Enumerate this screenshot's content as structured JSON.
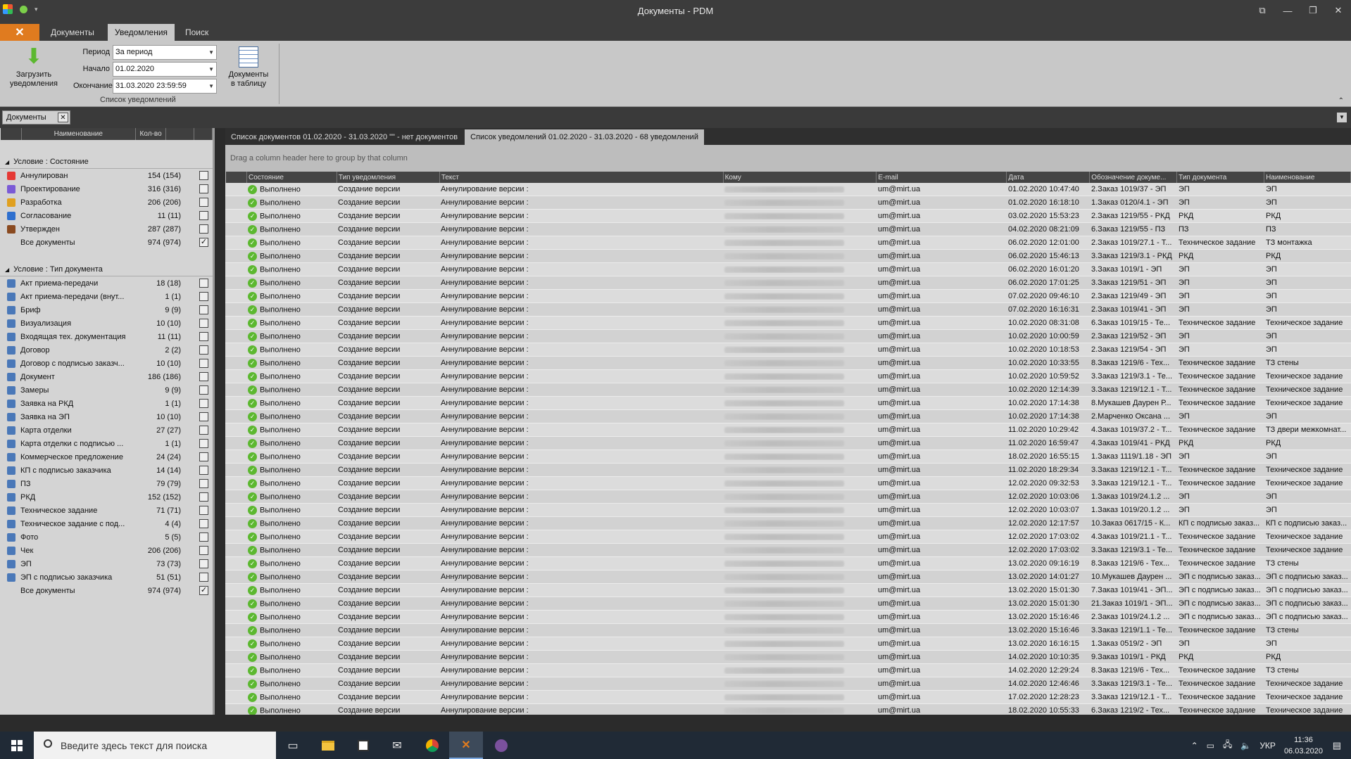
{
  "window": {
    "title": "Документы - PDM",
    "buttons": [
      "⧉",
      "—",
      "❐",
      "✕"
    ]
  },
  "ribbon_tabs": [
    {
      "label": "Документы"
    },
    {
      "label": "Уведомления"
    },
    {
      "label": "Поиск"
    }
  ],
  "ribbon": {
    "load_button": "Загрузить уведомления",
    "load_button_l1": "Загрузить",
    "load_button_l2": "уведомления",
    "period_label": "Период",
    "period_value": "За период",
    "start_label": "Начало",
    "start_value": "01.02.2020",
    "end_label": "Окончание",
    "end_value": "31.03.2020 23:59:59",
    "to_table_l1": "Документы",
    "to_table_l2": "в таблицу",
    "group_label": "Список уведомлений"
  },
  "doc_tab": {
    "label": "Документы",
    "close": "✕"
  },
  "left": {
    "headers": [
      "Наименование",
      "Кол-во"
    ],
    "state_group": "Условие : Состояние",
    "state_items": [
      {
        "name": "Аннулирован",
        "count": "154 (154)",
        "icon": "cancel-icon",
        "checked": false
      },
      {
        "name": "Проектирование",
        "count": "316 (316)",
        "icon": "design-icon",
        "checked": false
      },
      {
        "name": "Разработка",
        "count": "206 (206)",
        "icon": "pencil-icon",
        "checked": false
      },
      {
        "name": "Согласование",
        "count": "11 (11)",
        "icon": "approve-icon",
        "checked": false
      },
      {
        "name": "Утвержден",
        "count": "287 (287)",
        "icon": "stamp-icon",
        "checked": false
      },
      {
        "name": "Все документы",
        "count": "974 (974)",
        "icon": "",
        "checked": true
      }
    ],
    "type_group": "Условие : Тип документа",
    "type_items": [
      {
        "name": "Акт приема-передачи",
        "count": "18 (18)",
        "checked": false
      },
      {
        "name": "Акт приема-передачи (внут...",
        "count": "1 (1)",
        "checked": false
      },
      {
        "name": "Бриф",
        "count": "9 (9)",
        "checked": false
      },
      {
        "name": "Визуализация",
        "count": "10 (10)",
        "checked": false
      },
      {
        "name": "Входящая тех. документация",
        "count": "11 (11)",
        "checked": false
      },
      {
        "name": "Договор",
        "count": "2 (2)",
        "checked": false
      },
      {
        "name": "Договор с подписью заказч...",
        "count": "10 (10)",
        "checked": false
      },
      {
        "name": "Документ",
        "count": "186 (186)",
        "checked": false
      },
      {
        "name": "Замеры",
        "count": "9 (9)",
        "checked": false
      },
      {
        "name": "Заявка на РКД",
        "count": "1 (1)",
        "checked": false
      },
      {
        "name": "Заявка на ЭП",
        "count": "10 (10)",
        "checked": false
      },
      {
        "name": "Карта отделки",
        "count": "27 (27)",
        "checked": false
      },
      {
        "name": "Карта отделки с подписью ...",
        "count": "1 (1)",
        "checked": false
      },
      {
        "name": "Коммерческое предложение",
        "count": "24 (24)",
        "checked": false
      },
      {
        "name": "КП с подписью заказчика",
        "count": "14 (14)",
        "checked": false
      },
      {
        "name": "ПЗ",
        "count": "79 (79)",
        "checked": false
      },
      {
        "name": "РКД",
        "count": "152 (152)",
        "checked": false
      },
      {
        "name": "Техническое задание",
        "count": "71 (71)",
        "checked": false
      },
      {
        "name": "Техническое задание с под...",
        "count": "4 (4)",
        "checked": false
      },
      {
        "name": "Фото",
        "count": "5 (5)",
        "checked": false
      },
      {
        "name": "Чек",
        "count": "206 (206)",
        "checked": false
      },
      {
        "name": "ЭП",
        "count": "73 (73)",
        "checked": false
      },
      {
        "name": "ЭП с подписью заказчика",
        "count": "51 (51)",
        "checked": false
      },
      {
        "name": "Все документы",
        "count": "974 (974)",
        "checked": true
      }
    ]
  },
  "right_tabs": [
    {
      "label": "Список документов 01.02.2020 - 31.03.2020 \"\" - нет документов"
    },
    {
      "label": "Список уведомлений 01.02.2020 - 31.03.2020 - 68 уведомлений"
    }
  ],
  "grid": {
    "group_hint": "Drag a column header here to group by that column",
    "columns": [
      "Состояние",
      "Тип уведомления",
      "Текст",
      "Кому",
      "E-mail",
      "Дата",
      "Обозначение докуме...",
      "Тип документа",
      "Наименование"
    ],
    "status": "Выполнено",
    "notif_type": "Создание версии",
    "text": "Аннулирование версии :",
    "email": "um@mirt.ua",
    "rows": [
      [
        "01.02.2020 10:47:40",
        "2.Заказ 1019/37 - ЭП",
        "ЭП",
        "ЭП"
      ],
      [
        "01.02.2020 16:18:10",
        "1.Заказ 0120/4.1 - ЭП",
        "ЭП",
        "ЭП"
      ],
      [
        "03.02.2020 15:53:23",
        "2.Заказ 1219/55 - РКД",
        "РКД",
        "РКД"
      ],
      [
        "04.02.2020 08:21:09",
        "6.Заказ 1219/55 - ПЗ",
        "ПЗ",
        "ПЗ"
      ],
      [
        "06.02.2020 12:01:00",
        "2.Заказ 1019/27.1 - Т...",
        "Техническое задание",
        "ТЗ монтажка"
      ],
      [
        "06.02.2020 15:46:13",
        "3.Заказ 1219/3.1 - РКД",
        "РКД",
        "РКД"
      ],
      [
        "06.02.2020 16:01:20",
        "3.Заказ 1019/1 - ЭП",
        "ЭП",
        "ЭП"
      ],
      [
        "06.02.2020 17:01:25",
        "3.Заказ 1219/51 - ЭП",
        "ЭП",
        "ЭП"
      ],
      [
        "07.02.2020 09:46:10",
        "2.Заказ 1219/49 - ЭП",
        "ЭП",
        "ЭП"
      ],
      [
        "07.02.2020 16:16:31",
        "2.Заказ 1019/41 - ЭП",
        "ЭП",
        "ЭП"
      ],
      [
        "10.02.2020 08:31:08",
        "6.Заказ 1019/15 - Те...",
        "Техническое задание",
        "Техническое задание"
      ],
      [
        "10.02.2020 10:00:59",
        "2.Заказ 1219/52 - ЭП",
        "ЭП",
        "ЭП"
      ],
      [
        "10.02.2020 10:18:53",
        "2.Заказ 1219/54 - ЭП",
        "ЭП",
        "ЭП"
      ],
      [
        "10.02.2020 10:33:55",
        "8.Заказ 1219/6 - Тех...",
        "Техническое задание",
        "ТЗ стены"
      ],
      [
        "10.02.2020 10:59:52",
        "3.Заказ 1219/3.1 - Те...",
        "Техническое задание",
        "Техническое задание"
      ],
      [
        "10.02.2020 12:14:39",
        "3.Заказ 1219/12.1 - Т...",
        "Техническое задание",
        "Техническое задание"
      ],
      [
        "10.02.2020 17:14:38",
        "8.Мукашев Даурен Р...",
        "Техническое задание",
        "Техническое задание"
      ],
      [
        "10.02.2020 17:14:38",
        "2.Марченко Оксана ...",
        "ЭП",
        "ЭП"
      ],
      [
        "11.02.2020 10:29:42",
        "4.Заказ 1019/37.2 - Т...",
        "Техническое задание",
        "ТЗ двери межкомнат..."
      ],
      [
        "11.02.2020 16:59:47",
        "4.Заказ 1019/41 - РКД",
        "РКД",
        "РКД"
      ],
      [
        "18.02.2020 16:55:15",
        "1.Заказ 1119/1.18 - ЭП",
        "ЭП",
        "ЭП"
      ],
      [
        "11.02.2020 18:29:34",
        "3.Заказ 1219/12.1 - Т...",
        "Техническое задание",
        "Техническое задание"
      ],
      [
        "12.02.2020 09:32:53",
        "3.Заказ 1219/12.1 - Т...",
        "Техническое задание",
        "Техническое задание"
      ],
      [
        "12.02.2020 10:03:06",
        "1.Заказ 1019/24.1.2 ...",
        "ЭП",
        "ЭП"
      ],
      [
        "12.02.2020 10:03:07",
        "1.Заказ 1019/20.1.2 ...",
        "ЭП",
        "ЭП"
      ],
      [
        "12.02.2020 12:17:57",
        "10.Заказ 0617/15 - К...",
        "КП с подписью заказ...",
        "КП с подписью заказ..."
      ],
      [
        "12.02.2020 17:03:02",
        "4.Заказ 1019/21.1 - Т...",
        "Техническое задание",
        "Техническое задание"
      ],
      [
        "12.02.2020 17:03:02",
        "3.Заказ 1219/3.1 - Те...",
        "Техническое задание",
        "Техническое задание"
      ],
      [
        "13.02.2020 09:16:19",
        "8.Заказ 1219/6 - Тех...",
        "Техническое задание",
        "ТЗ стены"
      ],
      [
        "13.02.2020 14:01:27",
        "10.Мукашев Даурен ...",
        "ЭП с подписью заказ...",
        "ЭП с подписью заказ..."
      ],
      [
        "13.02.2020 15:01:30",
        "7.Заказ 1019/41 - ЭП...",
        "ЭП с подписью заказ...",
        "ЭП с подписью заказ..."
      ],
      [
        "13.02.2020 15:01:30",
        "21.Заказ 1019/1 - ЭП...",
        "ЭП с подписью заказ...",
        "ЭП с подписью заказ..."
      ],
      [
        "13.02.2020 15:16:46",
        "2.Заказ 1019/24.1.2 ...",
        "ЭП с подписью заказ...",
        "ЭП с подписью заказ..."
      ],
      [
        "13.02.2020 15:16:46",
        "3.Заказ 1219/1.1 - Те...",
        "Техническое задание",
        "ТЗ стены"
      ],
      [
        "13.02.2020 16:16:15",
        "1.Заказ 0519/2 - ЭП",
        "ЭП",
        "ЭП"
      ],
      [
        "14.02.2020 10:10:35",
        "9.Заказ 1019/1 - РКД",
        "РКД",
        "РКД"
      ],
      [
        "14.02.2020 12:29:24",
        "8.Заказ 1219/6 - Тех...",
        "Техническое задание",
        "ТЗ стены"
      ],
      [
        "14.02.2020 12:46:46",
        "3.Заказ 1219/3.1 - Те...",
        "Техническое задание",
        "Техническое задание"
      ],
      [
        "17.02.2020 12:28:23",
        "3.Заказ 1219/12.1 - Т...",
        "Техническое задание",
        "Техническое задание"
      ],
      [
        "18.02.2020 10:55:33",
        "6.Заказ 1219/2 - Тех...",
        "Техническое задание",
        "Техническое задание"
      ]
    ]
  },
  "taskbar": {
    "search_placeholder": "Введите здесь текст для поиска",
    "lang": "УКР",
    "time": "11:36",
    "date": "06.03.2020"
  },
  "colors": {
    "accent": "#e07b1f",
    "ok": "#5cb830",
    "dark": "#3c3c3c"
  }
}
